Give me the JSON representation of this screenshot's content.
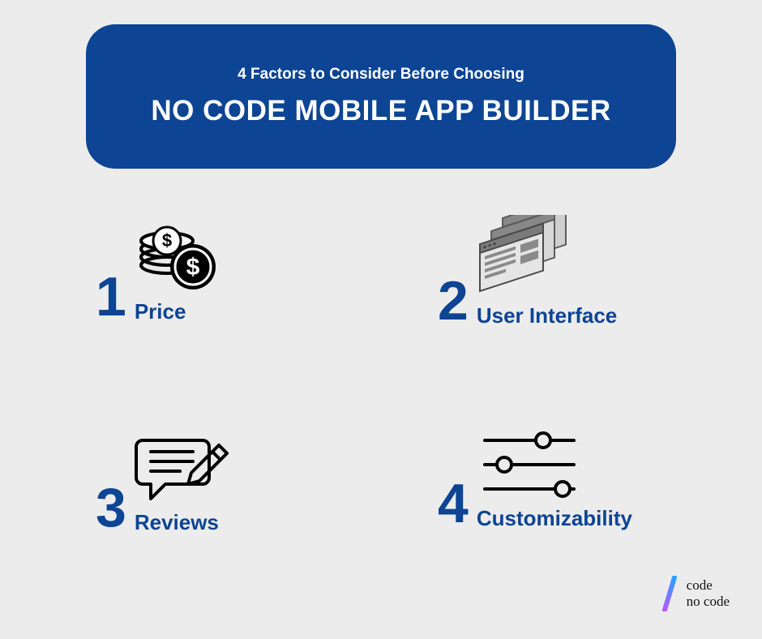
{
  "banner": {
    "subtitle": "4 Factors to Consider Before Choosing",
    "title": "NO CODE MOBILE APP BUILDER"
  },
  "factors": [
    {
      "num": "1",
      "label": "Price"
    },
    {
      "num": "2",
      "label": "User Interface"
    },
    {
      "num": "3",
      "label": "Reviews"
    },
    {
      "num": "4",
      "label": "Customizability"
    }
  ],
  "brand": {
    "line1": "code",
    "line2": "no code"
  },
  "colors": {
    "accent": "#0d4494",
    "bg": "#ececec"
  }
}
